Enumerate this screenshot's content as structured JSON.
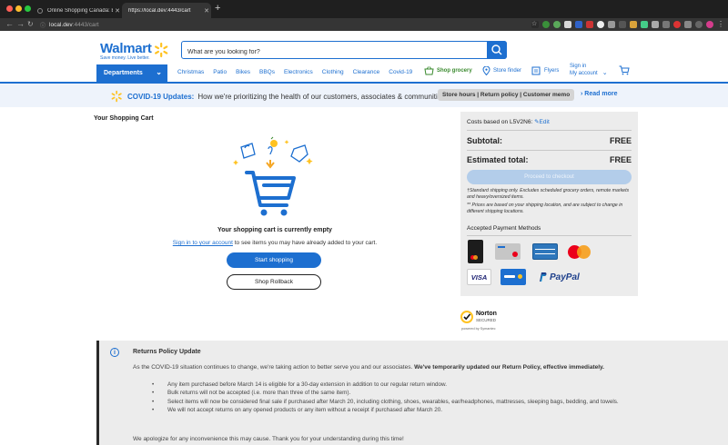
{
  "browser": {
    "tabs": [
      {
        "title": "Online Shopping Canada: Every",
        "active": false
      },
      {
        "title": "https://local.dev:4443/cart",
        "active": true
      }
    ],
    "url_host": "local.dev",
    "url_rest": ":4443/cart"
  },
  "header": {
    "logo_word": "Walmart",
    "logo_tagline": "Save money. Live better.",
    "search_placeholder": "What are you looking for?",
    "departments_label": "Departments",
    "nav_links": [
      "Christmas",
      "Patio",
      "Bikes",
      "BBQs",
      "Electronics",
      "Clothing",
      "Clearance",
      "Covid-19"
    ],
    "shop_grocery": "Shop grocery",
    "store_finder": "Store finder",
    "flyers": "Flyers",
    "sign_in": "Sign in",
    "my_account": "My account"
  },
  "covid_banner": {
    "title": "COVID-19 Updates:",
    "text": "How we're prioritizing the health of our customers, associates & communities.",
    "pill": "Store hours | Return policy | Customer memo",
    "read_more": "Read more"
  },
  "cart": {
    "title": "Your Shopping Cart",
    "empty_message": "Your shopping cart is currently empty",
    "signin_link": "Sign in to your account",
    "signin_rest": " to see items you may have already added to your cart.",
    "start_shopping": "Start shopping",
    "shop_rollback": "Shop Rollback"
  },
  "summary": {
    "costs_label": "Costs based on L5V2N6:",
    "edit_label": "Edit",
    "subtotal_label": "Subtotal:",
    "subtotal_value": "FREE",
    "estimated_label": "Estimated total:",
    "estimated_value": "FREE",
    "checkout_label": "Proceed to checkout",
    "note1": "†Standard shipping only. Excludes scheduled grocery orders, remote markets and heavy/oversized items.",
    "note2": "** Prices are based on your shipping location, and are subject to change in different shipping locations.",
    "payment_title": "Accepted Payment Methods",
    "payment_methods": [
      "walmart-mastercard",
      "walmart-gift-card",
      "american-express",
      "mastercard",
      "visa",
      "walmart-card",
      "paypal"
    ],
    "paypal_label": "PayPal",
    "visa_label": "VISA"
  },
  "norton": {
    "name": "Norton",
    "secured": "SECURED",
    "powered": "powered by Symantec"
  },
  "policy": {
    "title": "Returns Policy Update",
    "lead_plain": "As the COVID-19 situation continues to change, we're taking action to better serve you and our associates. ",
    "lead_bold": "We've temporarily updated our Return Policy, effective immediately.",
    "items": [
      "Any item purchased before March 14 is eligible for a 30-day extension in addition to our regular return window.",
      "Bulk returns will not be accepted (i.e. more than three of the same item).",
      "Select items will now be considered final sale if purchased after March 20, including clothing, shoes, wearables, ear/headphones, mattresses, sleeping bags, bedding, and towels.",
      "We will not accept returns on any opened products or any item without a receipt if purchased after March 20."
    ],
    "footer": "We apologize for any inconvenience this may cause. Thank you for your understanding during this time!"
  },
  "colors": {
    "brand_blue": "#1d6fd0",
    "spark_yellow": "#ffc220"
  }
}
